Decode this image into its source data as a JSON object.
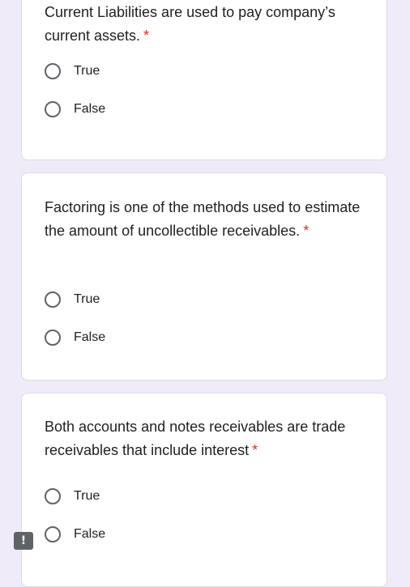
{
  "questions": [
    {
      "text": "Current Liabilities are used to pay company’s current assets.",
      "required_mark": "*",
      "options": [
        "True",
        "False"
      ]
    },
    {
      "text": "Factoring is one of the methods used to estimate the amount of uncollectible receivables.",
      "required_mark": "*",
      "options": [
        "True",
        "False"
      ]
    },
    {
      "text": "Both accounts and notes receivables are trade receivables that include interest",
      "required_mark": "*",
      "options": [
        "True",
        "False"
      ]
    }
  ],
  "feedback_button": {
    "icon": "exclamation-icon",
    "glyph": "!"
  },
  "colors": {
    "background": "#efebf8",
    "card": "#ffffff",
    "required": "#d93025",
    "radio_border": "#5f6368"
  }
}
